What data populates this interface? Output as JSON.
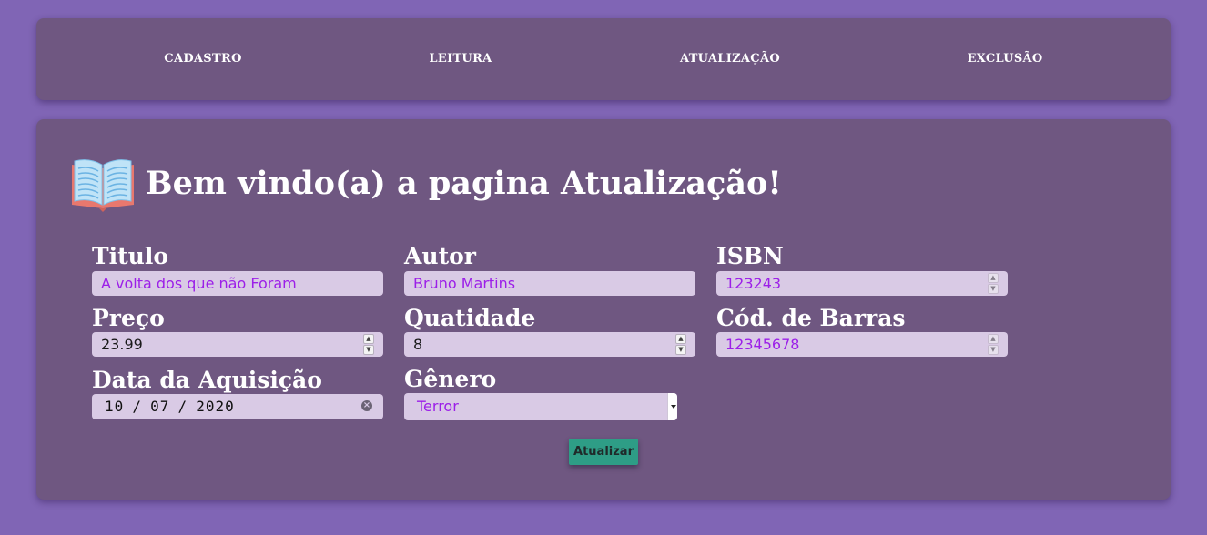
{
  "nav": {
    "items": [
      {
        "label": "CADASTRO"
      },
      {
        "label": "LEITURA"
      },
      {
        "label": "ATUALIZAÇÃO"
      },
      {
        "label": "EXCLUSÃO"
      }
    ]
  },
  "page": {
    "title": "Bem vindo(a) a pagina Atualização!",
    "hero_icon": "open-book-icon"
  },
  "form": {
    "titulo": {
      "label": "Titulo",
      "value": "A volta dos que não Foram"
    },
    "autor": {
      "label": "Autor",
      "value": "Bruno Martins"
    },
    "isbn": {
      "label": "ISBN",
      "value": "123243"
    },
    "preco": {
      "label": "Preço",
      "value": "23.99"
    },
    "quantidade": {
      "label": "Quatidade",
      "value": "8"
    },
    "codigo_barras": {
      "label": "Cód. de Barras",
      "value": "12345678"
    },
    "data_aquisicao": {
      "label": "Data da Aquisição",
      "day": "10",
      "month": "07",
      "year": "2020",
      "separator": "/"
    },
    "genero": {
      "label": "Gênero",
      "value": "Terror"
    },
    "submit_label": "Atualizar"
  },
  "colors": {
    "background": "#8065b5",
    "card": "#6f5781",
    "field": "#d9cae5",
    "field_text": "#9c1fe8",
    "button": "#2e9d86"
  }
}
